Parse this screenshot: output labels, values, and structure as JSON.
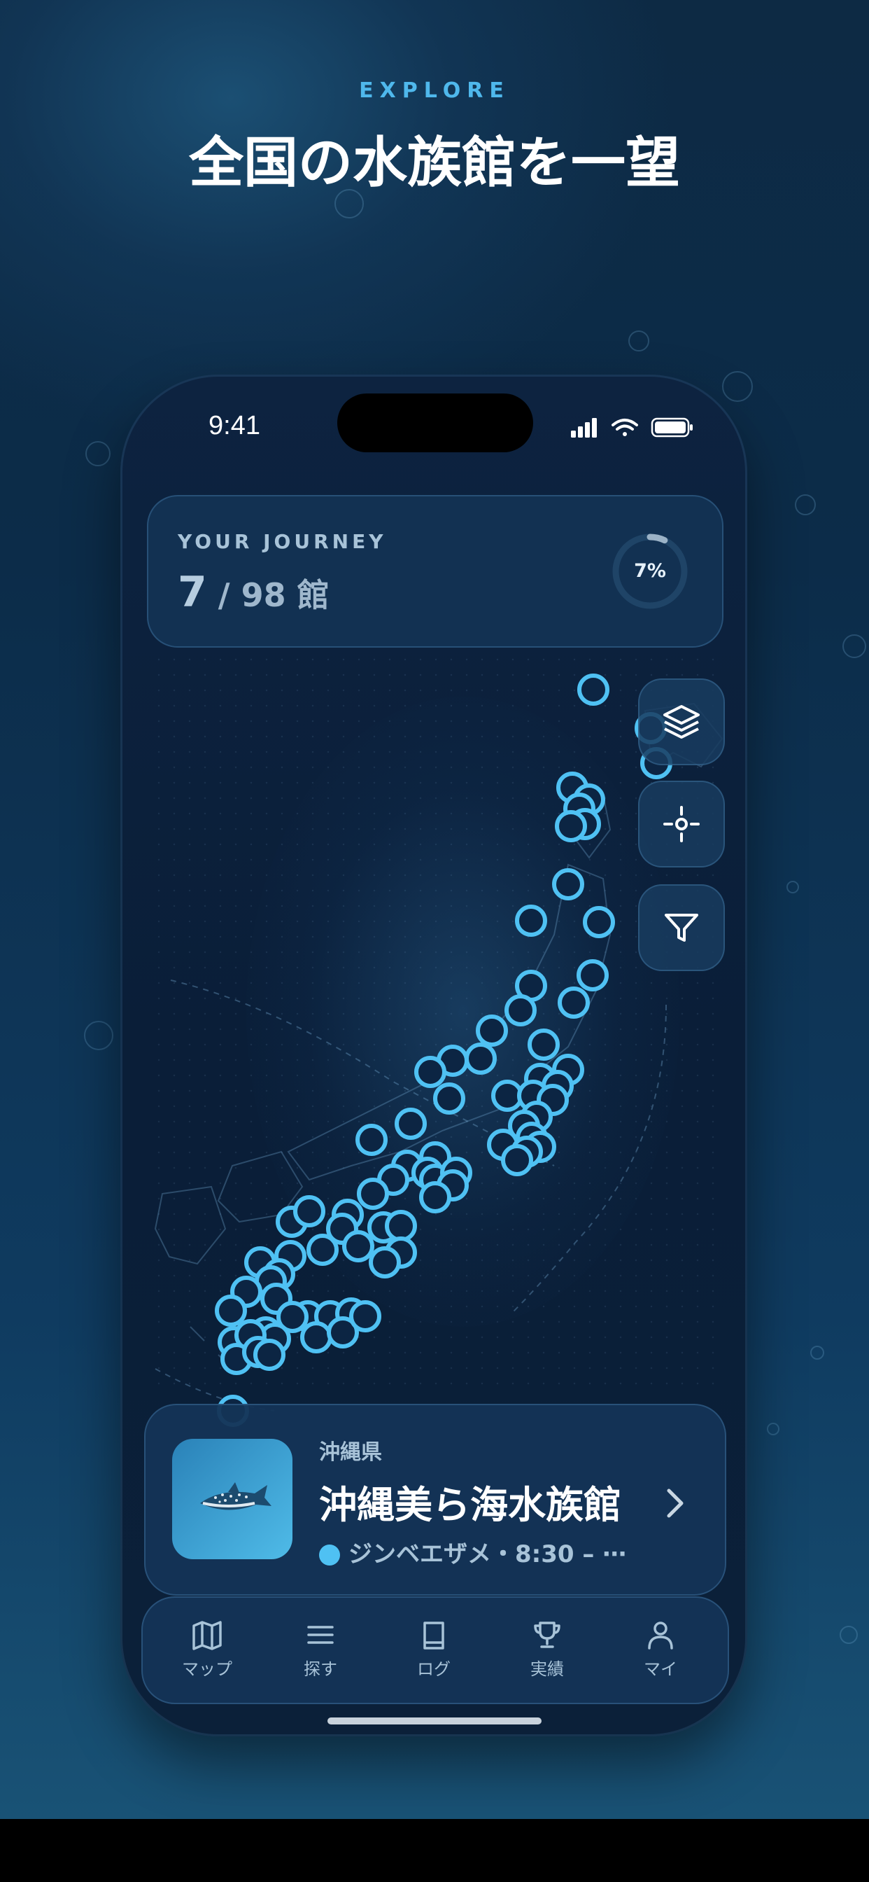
{
  "hero": {
    "eyebrow": "EXPLORE",
    "headline": "全国の水族館を一望"
  },
  "status_bar": {
    "time": "9:41"
  },
  "journey": {
    "title": "YOUR JOURNEY",
    "visited": "7",
    "total_label": " / 98 館",
    "progress_percent": 7,
    "progress_label": "7%"
  },
  "map_controls": [
    {
      "icon": "layers-icon"
    },
    {
      "icon": "locate-icon"
    },
    {
      "icon": "filter-icon"
    }
  ],
  "featured": {
    "prefecture": "沖縄県",
    "name": "沖縄美ら海水族館",
    "meta": "ジンベエザメ・8:30 – ⋯",
    "thumbnail_icon": "whale-shark-icon"
  },
  "tabs": [
    {
      "label": "マップ",
      "icon": "map-icon"
    },
    {
      "label": "探す",
      "icon": "list-icon"
    },
    {
      "label": "ログ",
      "icon": "book-icon"
    },
    {
      "label": "実績",
      "icon": "trophy-icon"
    },
    {
      "label": "マイ",
      "icon": "person-icon"
    }
  ],
  "colors": {
    "accent": "#4FC1F3",
    "background": "#0C2C49",
    "card": "#143456"
  }
}
